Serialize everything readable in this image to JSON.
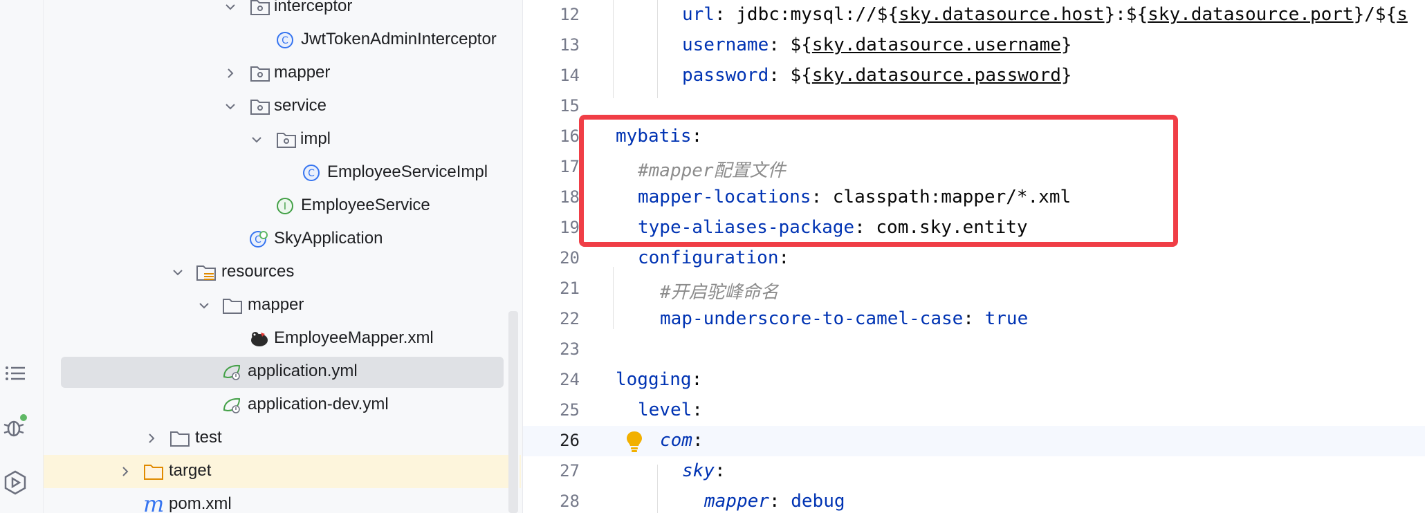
{
  "tool_strip": {
    "icons": [
      "structure-icon",
      "debug-icon",
      "services-icon"
    ]
  },
  "project_tree": {
    "items": [
      {
        "label": "interceptor",
        "kind": "package",
        "expanded": true
      },
      {
        "label": "JwtTokenAdminInterceptor",
        "kind": "class"
      },
      {
        "label": "mapper",
        "kind": "package",
        "expanded": false
      },
      {
        "label": "service",
        "kind": "package",
        "expanded": true
      },
      {
        "label": "impl",
        "kind": "package",
        "expanded": true
      },
      {
        "label": "EmployeeServiceImpl",
        "kind": "class"
      },
      {
        "label": "EmployeeService",
        "kind": "interface"
      },
      {
        "label": "SkyApplication",
        "kind": "spring-app"
      },
      {
        "label": "resources",
        "kind": "resources-folder",
        "expanded": true
      },
      {
        "label": "mapper",
        "kind": "folder",
        "expanded": true
      },
      {
        "label": "EmployeeMapper.xml",
        "kind": "mybatis-xml"
      },
      {
        "label": "application.yml",
        "kind": "spring-yml",
        "selected": true
      },
      {
        "label": "application-dev.yml",
        "kind": "spring-yml"
      },
      {
        "label": "test",
        "kind": "folder",
        "expanded": false
      },
      {
        "label": "target",
        "kind": "excluded-folder",
        "expanded": false
      },
      {
        "label": "pom.xml",
        "kind": "maven"
      }
    ]
  },
  "editor": {
    "line_numbers": [
      "12",
      "13",
      "14",
      "15",
      "16",
      "17",
      "18",
      "19",
      "20",
      "21",
      "22",
      "23",
      "24",
      "25",
      "26",
      "27",
      "28"
    ],
    "current_line": "26",
    "lines": {
      "l12": {
        "key": "url",
        "colon": ": ",
        "t1": "jdbc:mysql://${",
        "ref1": "sky.datasource.host",
        "t2": "}:${",
        "ref2": "sky.datasource.port",
        "t3": "}/${",
        "ref3": "s"
      },
      "l13": {
        "key": "username",
        "colon": ": ",
        "t1": "${",
        "ref1": "sky.datasource.username",
        "t2": "}"
      },
      "l14": {
        "key": "password",
        "colon": ": ",
        "t1": "${",
        "ref1": "sky.datasource.password",
        "t2": "}"
      },
      "l16": {
        "key": "mybatis",
        "colon": ":"
      },
      "l17": {
        "comment": "#mapper配置文件"
      },
      "l18": {
        "key": "mapper-locations",
        "colon": ": ",
        "value": "classpath:mapper/*.xml"
      },
      "l19": {
        "key": "type-aliases-package",
        "colon": ": ",
        "value": "com.sky.entity"
      },
      "l20": {
        "key": "configuration",
        "colon": ":"
      },
      "l21": {
        "comment": "#开启驼峰命名"
      },
      "l22": {
        "key": "map-underscore-to-camel-case",
        "colon": ": ",
        "value": "true"
      },
      "l24": {
        "key": "logging",
        "colon": ":"
      },
      "l25": {
        "key": "level",
        "colon": ":"
      },
      "l26": {
        "key": "com",
        "colon": ":"
      },
      "l27": {
        "key": "sky",
        "colon": ":"
      },
      "l28": {
        "key": "mapper",
        "colon": ": ",
        "value": "debug"
      }
    }
  },
  "colors": {
    "highlight_box": "#f03e46",
    "key": "#0033b3",
    "comment": "#8c8c8c",
    "value_keyword": "#067d17"
  }
}
